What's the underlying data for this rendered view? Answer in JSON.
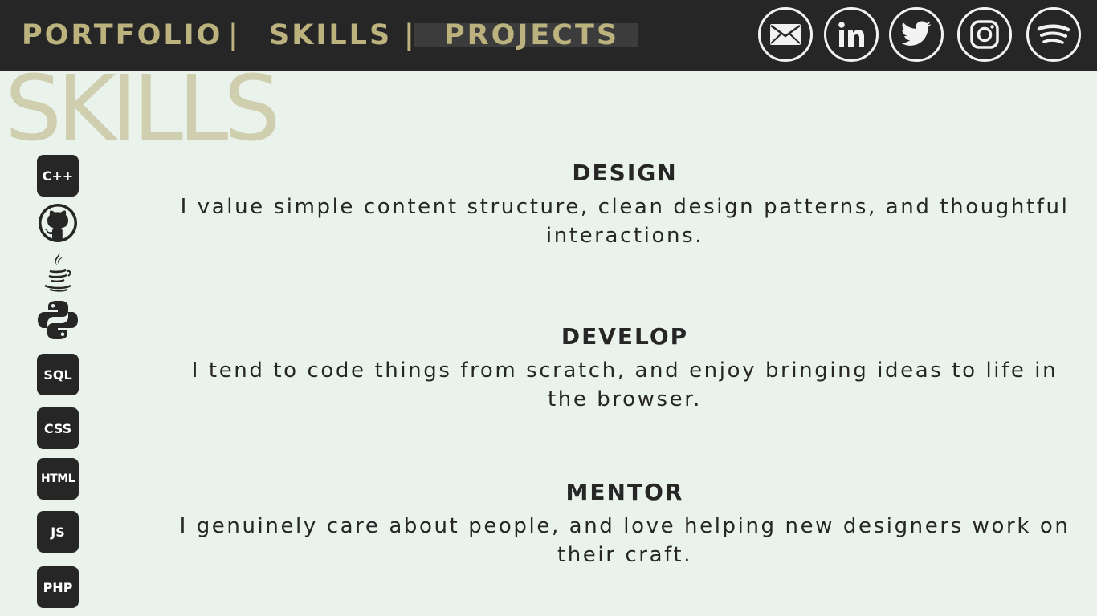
{
  "nav": {
    "portfolio": "PORTFOLIO",
    "sep1": "|",
    "skills": "SKILLS",
    "sep2": "|",
    "projects": "PROJECTS"
  },
  "social": [
    "mail-icon",
    "linkedin-icon",
    "twitter-icon",
    "instagram-icon",
    "spotify-icon"
  ],
  "page_title": "SKILLS",
  "skill_icons": [
    "C++",
    "github-icon",
    "java-icon",
    "python-icon",
    "SQL",
    "CSS",
    "HTML",
    "JS",
    "PHP"
  ],
  "sections": [
    {
      "title": "DESIGN",
      "text": "I value simple content structure, clean design patterns, and thoughtful interactions."
    },
    {
      "title": "DEVELOP",
      "text": "I tend to code things from scratch, and enjoy bringing ideas to life in the browser."
    },
    {
      "title": "MENTOR",
      "text": "I genuinely care about people, and love helping new designers work on their craft."
    }
  ],
  "colors": {
    "topbar": "#262626",
    "accent": "#bbb27e",
    "background": "#e9f3ec",
    "title": "#cfceaf"
  }
}
